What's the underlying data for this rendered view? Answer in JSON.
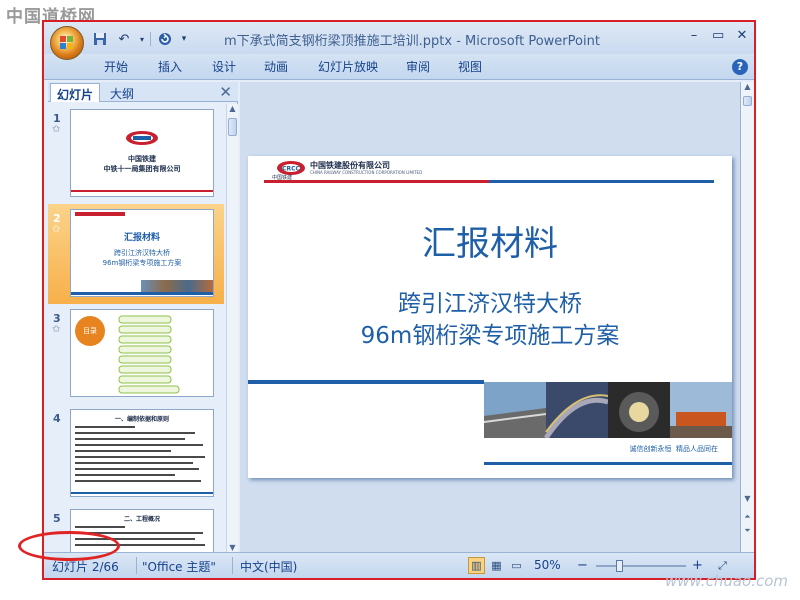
{
  "watermarks": {
    "top": "中国道桥网",
    "bottom": "www.chuao.com"
  },
  "titlebar": {
    "title": "m下承式简支钢桁梁顶推施工培训.pptx - Microsoft PowerPoint"
  },
  "qat": {
    "save_icon": "save-icon",
    "undo_icon": "undo-icon",
    "redo_icon": "redo-icon",
    "customize_icon": "chevron-down-icon"
  },
  "window_controls": {
    "minimize": "–",
    "restore": "▭",
    "close": "✕"
  },
  "ribbon": {
    "tabs": [
      "开始",
      "插入",
      "设计",
      "动画",
      "幻灯片放映",
      "审阅",
      "视图"
    ],
    "help": "?"
  },
  "pane": {
    "tabs": [
      "幻灯片",
      "大纲"
    ],
    "close": "✕",
    "thumbs": [
      {
        "number": "1",
        "company_line1": "中国铁建",
        "company_line2": "中铁十一局集团有限公司"
      },
      {
        "number": "2",
        "title": "汇报材料",
        "line1": "跨引江济汉特大桥",
        "line2": "96m钢桁梁专项施工方案"
      },
      {
        "number": "3",
        "toc_label": "目录"
      },
      {
        "number": "4",
        "heading": "一、编制依据和原则"
      },
      {
        "number": "5",
        "heading": "二、工程概况"
      }
    ]
  },
  "slide": {
    "company_cn": "中国铁建股份有限公司",
    "company_en": "CHINA RAILWAY CONSTRUCTION CORPORATION LIMITED",
    "logo_text": "CRCC",
    "logo_caption": "中国铁建",
    "title": "汇报材料",
    "subtitle_line1": "跨引江济汉特大桥",
    "subtitle_line2": "96m钢桁梁专项施工方案",
    "slogan": "诚信创新永恒  精品人品同在",
    "accent_blue": "#1f5fa8",
    "accent_red": "#c8202e"
  },
  "statusbar": {
    "slide_indicator": "幻灯片 2/66",
    "theme": "\"Office 主题\"",
    "language": "中文(中国)",
    "zoom": "50%",
    "zoom_minus": "−",
    "zoom_plus": "+",
    "zoom_level": 0.5
  }
}
